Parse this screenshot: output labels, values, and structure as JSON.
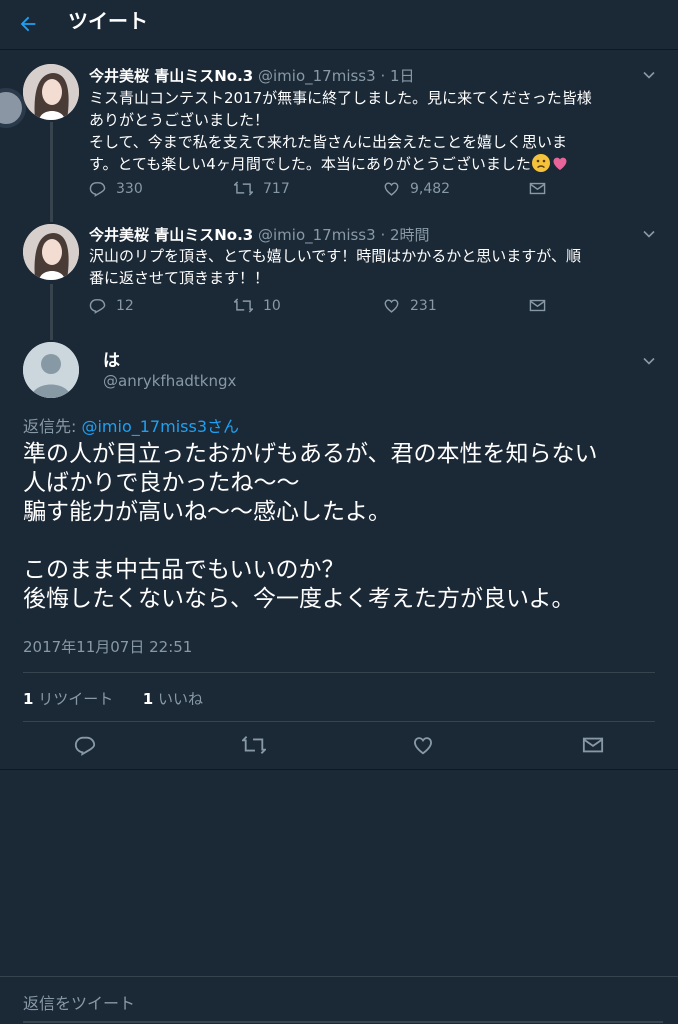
{
  "header": {
    "title": "ツイート",
    "back_icon": "arrow-left-icon"
  },
  "thread": [
    {
      "name": "今井美桜 青山ミスNo.3",
      "handle": "@imio_17miss3",
      "time": "1日",
      "body": [
        "ミス青山コンテスト2017が無事に終了しました。見に来てくださった皆様",
        "ありがとうございました！",
        "そして、今まで私を支えて来れた皆さんに出会えたことを嬉しく思いま",
        "す。とても楽しい4ヶ月間でした。本当にありがとうございました"
      ],
      "replies": "330",
      "retweets": "717",
      "likes": "9,482"
    },
    {
      "name": "今井美桜 青山ミスNo.3",
      "handle": "@imio_17miss3",
      "time": "2時間",
      "body": [
        "沢山のリプを頂き、とても嬉しいです！時間はかかるかと思いますが、順",
        "番に返させて頂きます！！"
      ],
      "replies": "12",
      "retweets": "10",
      "likes": "231"
    }
  ],
  "main": {
    "name": "は",
    "handle": "@anrykfhadtkngx",
    "reply_prefix": "返信先: ",
    "reply_to": "@imio_17miss3さん",
    "text": "準の人が目立ったおかげもあるが、君の本性を知らない\n人ばかりで良かったね〜〜\n騙す能力が高いね〜〜感心したよ。\n\nこのまま中古品でもいいのか？\n後悔したくないなら、今一度よく考えた方が良いよ。",
    "timestamp": "2017年11月07日 22:51",
    "retweet_count": "1",
    "retweet_label": "リツイート",
    "like_count": "1",
    "like_label": "いいね"
  },
  "reply_bar": {
    "placeholder": "返信をツイート"
  },
  "colors": {
    "background": "#1b2836",
    "accent": "#1da1f2",
    "muted": "#8899a6",
    "like": "#e0245e"
  }
}
